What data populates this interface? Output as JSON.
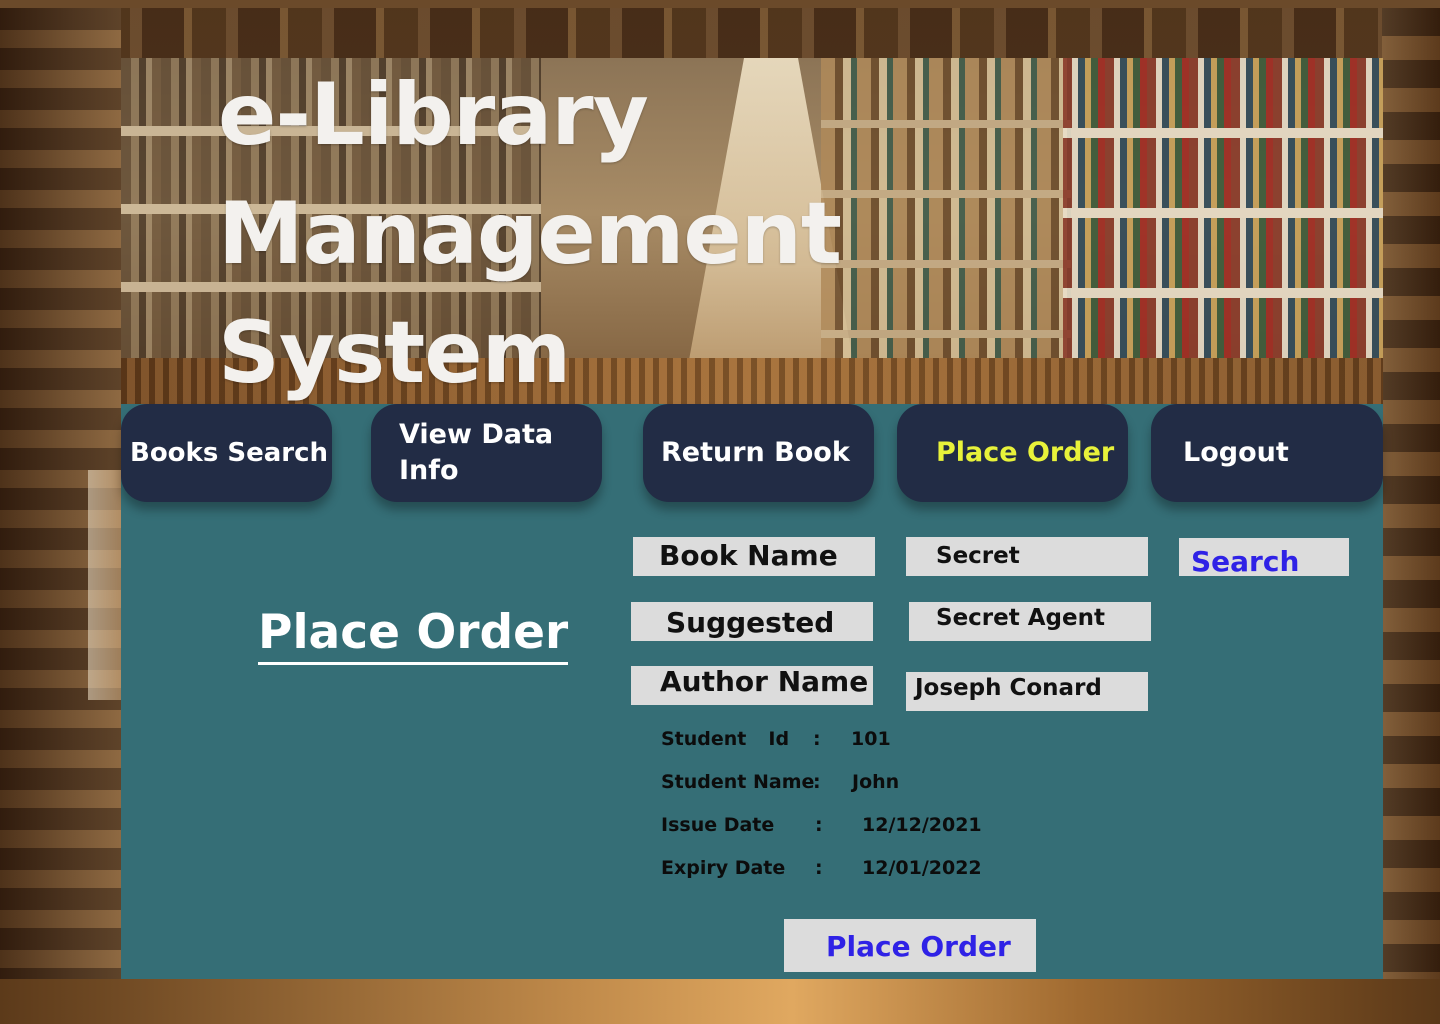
{
  "app": {
    "title": "e-Library Management System"
  },
  "nav": {
    "books_search": "Books Search",
    "view_data_line1": "View Data",
    "view_data_line2": "Info",
    "return_book": "Return Book",
    "place_order": "Place Order",
    "logout": "Logout",
    "active_color": "#e8f23a"
  },
  "page": {
    "heading": "Place Order"
  },
  "form": {
    "book_name_label": "Book Name",
    "book_name_value": "Secret",
    "suggested_label": "Suggested",
    "suggested_value": "Secret Agent",
    "author_label": "Author Name",
    "author_value": "Joseph Conard",
    "search_label": "Search"
  },
  "student": {
    "id_label_1": "Student",
    "id_label_2": "Id",
    "id_colon": ":",
    "id_value": "101",
    "name_label": "Student Name",
    "name_colon": ":",
    "name_value": "John",
    "issue_label": "Issue Date",
    "issue_colon": ":",
    "issue_value": "12/12/2021",
    "expiry_label": "Expiry Date",
    "expiry_colon": ":",
    "expiry_value": "12/01/2022"
  },
  "actions": {
    "place_order_button": "Place Order"
  },
  "colors": {
    "panel": "#356e76",
    "nav_button": "#222c45",
    "link_blue": "#2f22e6",
    "field_grey": "#dcdcdc"
  }
}
